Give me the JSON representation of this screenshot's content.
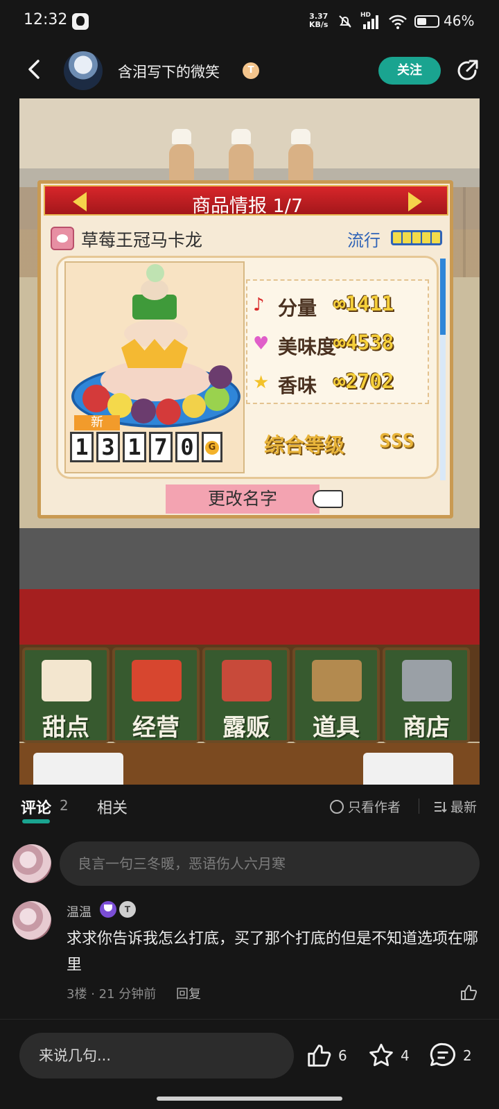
{
  "status_bar": {
    "time": "12:32",
    "net_speed_top": "3.37",
    "net_speed_bottom": "KB/s",
    "network": "HD",
    "battery_percent": "46%",
    "battery_level": 0.46
  },
  "header": {
    "author_name": "含泪写下的微笑",
    "author_tag": "T",
    "follow_label": "关注"
  },
  "game": {
    "panel_title": "商品情报 1/7",
    "item_name": "草莓王冠马卡龙",
    "trend_label": "流行",
    "trend_level": 5,
    "new_label": "新",
    "price_digits": [
      "1",
      "3",
      "1",
      "7",
      "0"
    ],
    "price_unit": "G",
    "stats": [
      {
        "icon": "music-note-icon",
        "glyph": "♪",
        "color": "#d82a2a",
        "label": "分量",
        "value": "∞1411"
      },
      {
        "icon": "heart-icon",
        "glyph": "♥",
        "color": "#e05ec9",
        "label": "美味度",
        "value": "∞4538"
      },
      {
        "icon": "star-icon",
        "glyph": "★",
        "color": "#f3c22a",
        "label": "香味",
        "value": "∞2702"
      }
    ],
    "rank_label": "综合等级",
    "rank_value": "SSS",
    "rename_label": "更改名字",
    "menu": [
      "甜点",
      "经营",
      "露贩",
      "道具",
      "商店"
    ]
  },
  "comments": {
    "tab_comments": "评论",
    "tab_comments_count": "2",
    "tab_related": "相关",
    "filter_author": "只看作者",
    "sort_label": "最新",
    "input_placeholder": "良言一句三冬暖，恶语伤人六月寒",
    "items": [
      {
        "user": "温温",
        "badge_tag": "T",
        "text": "求求你告诉我怎么打底，买了那个打底的但是不知道选项在哪里",
        "floor": "3楼",
        "time": "21 分钟前",
        "reply": "回复"
      }
    ]
  },
  "bottom_bar": {
    "placeholder": "来说几句...",
    "likes": "6",
    "favorites": "4",
    "comments": "2"
  },
  "colors": {
    "accent": "#1aa490",
    "background": "#161616"
  }
}
